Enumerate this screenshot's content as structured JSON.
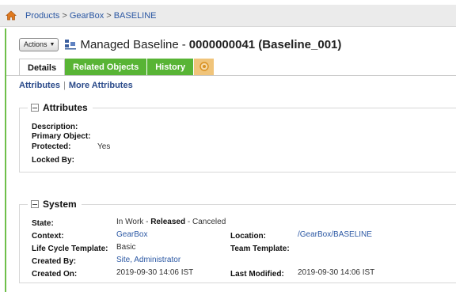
{
  "breadcrumb": {
    "items": [
      "Products",
      "GearBox",
      "BASELINE"
    ],
    "separator": ">"
  },
  "header": {
    "actions_label": "Actions",
    "title_type": "Managed Baseline",
    "title_sep": "-",
    "title_id": "0000000041 (Baseline_001)"
  },
  "tabs": [
    {
      "label": "Details",
      "active": true
    },
    {
      "label": "Related Objects"
    },
    {
      "label": "History"
    }
  ],
  "subnav": {
    "attributes": "Attributes",
    "separator": "|",
    "more": "More Attributes"
  },
  "attributes": {
    "title": "Attributes",
    "description_label": "Description:",
    "primary_object_label": "Primary Object:",
    "protected_label": "Protected:",
    "protected_value": "Yes",
    "locked_by_label": "Locked By:"
  },
  "system": {
    "title": "System",
    "state_label": "State:",
    "state_in_work": "In Work",
    "state_dash1": "-",
    "state_released": "Released",
    "state_dash2": "-",
    "state_canceled": "Canceled",
    "context_label": "Context:",
    "context_value": "GearBox",
    "location_label": "Location:",
    "location_value": "/GearBox/BASELINE",
    "lifecycle_label": "Life Cycle Template:",
    "lifecycle_value": "Basic",
    "team_label": "Team Template:",
    "created_by_label": "Created By:",
    "created_by_value": "Site, Administrator",
    "created_on_label": "Created On:",
    "created_on_value": "2019-09-30 14:06 IST",
    "last_modified_label": "Last Modified:",
    "last_modified_value": "2019-09-30 14:06 IST"
  },
  "colors": {
    "tab_green": "#58b435",
    "tab_orange": "#f0c47a",
    "link": "#2a57a3",
    "home_icon": "#e07a1f"
  },
  "icons": {
    "home": "home-icon",
    "object": "baseline-icon",
    "tab_extra": "circle-icon",
    "collapse": "collapse-icon"
  }
}
